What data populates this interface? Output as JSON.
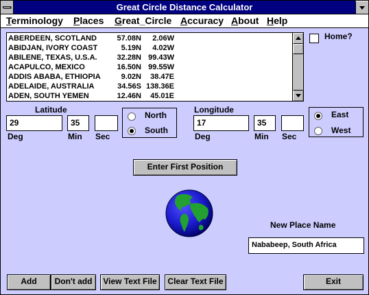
{
  "window": {
    "title": "Great Circle Distance Calculator"
  },
  "menu": [
    {
      "label": "Terminology",
      "accel": "T",
      "rest": "erminology"
    },
    {
      "label": "Places",
      "accel": "P",
      "rest": "laces"
    },
    {
      "label": "Great_Circle",
      "accel": "G",
      "rest": "reat_Circle"
    },
    {
      "label": "Accuracy",
      "accel": "A",
      "rest": "ccuracy"
    },
    {
      "label": "About",
      "accel": "A",
      "rest": "bout"
    },
    {
      "label": "Help",
      "accel": "H",
      "rest": "elp"
    }
  ],
  "places": [
    {
      "name": "ABERDEEN, SCOTLAND",
      "lat": "57.08N",
      "lon": "2.06W"
    },
    {
      "name": "ABIDJAN, IVORY COAST",
      "lat": "5.19N",
      "lon": "4.02W"
    },
    {
      "name": "ABILENE, TEXAS, U.S.A.",
      "lat": "32.28N",
      "lon": "99.43W"
    },
    {
      "name": "ACAPULCO, MEXICO",
      "lat": "16.50N",
      "lon": "99.55W"
    },
    {
      "name": "ADDIS ABABA, ETHIOPIA",
      "lat": "9.02N",
      "lon": "38.47E"
    },
    {
      "name": "ADELAIDE, AUSTRALIA",
      "lat": "34.56S",
      "lon": "138.36E"
    },
    {
      "name": "ADEN, SOUTH YEMEN",
      "lat": "12.46N",
      "lon": "45.01E"
    }
  ],
  "home": {
    "label": "Home?",
    "checked": false
  },
  "latitude": {
    "title": "Latitude",
    "deg": "29",
    "min": "35",
    "sec": "",
    "deg_label": "Deg",
    "min_label": "Min",
    "sec_label": "Sec",
    "options": [
      "North",
      "South"
    ],
    "selected": "South"
  },
  "longitude": {
    "title": "Longitude",
    "deg": "17",
    "min": "35",
    "sec": "",
    "deg_label": "Deg",
    "min_label": "Min",
    "sec_label": "Sec",
    "options": [
      "East",
      "West"
    ],
    "selected": "East"
  },
  "enter_button": "Enter First Position",
  "new_place": {
    "label": "New Place Name",
    "value": "Nababeep, South Africa"
  },
  "buttons": {
    "add": "Add",
    "dont_add": "Don't add",
    "view_text": "View Text File",
    "clear_text": "Clear Text File",
    "exit": "Exit"
  },
  "colors": {
    "background": "#ccccff",
    "titlebar": "#000080",
    "globe_ocean": "#1a1acc",
    "globe_land": "#22a030"
  }
}
